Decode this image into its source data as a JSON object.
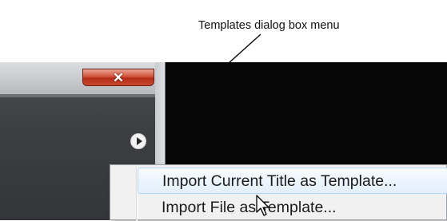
{
  "callout": {
    "label": "Templates dialog box menu"
  },
  "dialog": {
    "close_glyph": "✕",
    "menu_button_icon": "play-arrow-icon"
  },
  "menu": {
    "items": [
      {
        "label": "Import Current Title as Template..."
      },
      {
        "label": "Import File as Template..."
      }
    ]
  },
  "colors": {
    "close_red": "#c9482e",
    "highlight": "#e2effc",
    "dark_bg": "#060606"
  }
}
